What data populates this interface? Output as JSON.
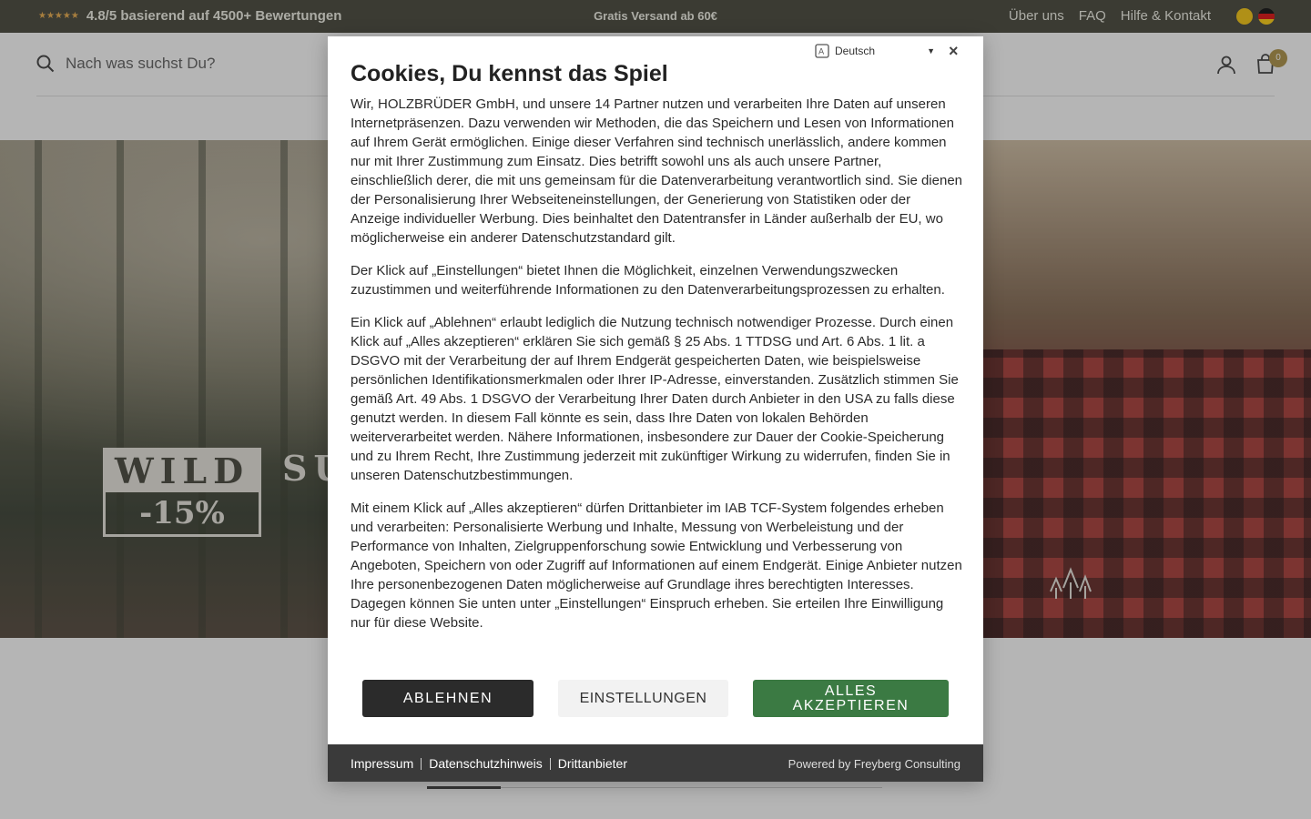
{
  "topbar": {
    "rating_stars": "★★★★★",
    "rating_text": "4.8/5 basierend auf 4500+ Bewertungen",
    "center_text": "Gratis Versand ab 60€",
    "links": [
      "Über uns",
      "FAQ",
      "Hilfe & Kontakt"
    ]
  },
  "header": {
    "search_placeholder": "Nach was suchst Du?",
    "cart_count": "0"
  },
  "hero": {
    "badge_top": "WILD",
    "badge_bottom": "-15%",
    "word": "SU"
  },
  "cookie_modal": {
    "language": "Deutsch",
    "close_icon": "×",
    "title": "Cookies, Du kennst das Spiel",
    "paragraphs": [
      "Wir, HOLZBRÜDER GmbH, und unsere 14 Partner nutzen und verarbeiten Ihre Daten auf unseren Internetpräsenzen. Dazu verwenden wir Methoden, die das Speichern und Lesen von Informationen auf Ihrem Gerät ermöglichen. Einige dieser Verfahren sind technisch unerlässlich, andere kommen nur mit Ihrer Zustimmung zum Einsatz. Dies betrifft sowohl uns als auch unsere Partner, einschließlich derer, die mit uns gemeinsam für die Datenverarbeitung verantwortlich sind. Sie dienen der Personalisierung Ihrer Webseiteneinstellungen, der Generierung von Statistiken oder der Anzeige individueller Werbung. Dies beinhaltet den Datentransfer in Länder außerhalb der EU, wo möglicherweise ein anderer Datenschutzstandard gilt.",
      "Der Klick auf „Einstellungen“ bietet Ihnen die Möglichkeit, einzelnen Verwendungszwecken zuzustimmen und weiterführende Informationen zu den Datenverarbeitungsprozessen zu erhalten.",
      "Ein Klick auf „Ablehnen“ erlaubt lediglich die Nutzung technisch notwendiger Prozesse. Durch einen Klick auf „Alles akzeptieren“ erklären Sie sich gemäß § 25 Abs. 1 TTDSG und Art. 6 Abs. 1 lit. a DSGVO mit der Verarbeitung der auf Ihrem Endgerät gespeicherten Daten, wie beispielsweise persönlichen Identifikationsmerkmalen oder Ihrer IP-Adresse, einverstanden. Zusätzlich stimmen Sie gemäß Art. 49 Abs. 1 DSGVO der Verarbeitung Ihrer Daten durch Anbieter in den USA zu falls diese genutzt werden. In diesem Fall könnte es sein, dass Ihre Daten von lokalen Behörden weiterverarbeitet werden. Nähere Informationen, insbesondere zur Dauer der Cookie-Speicherung und zu Ihrem Recht, Ihre Zustimmung jederzeit mit zukünftiger Wirkung zu widerrufen, finden Sie in unseren Datenschutzbestimmungen.",
      "Mit einem Klick auf „Alles akzeptieren“ dürfen Drittanbieter im IAB TCF-System folgendes erheben und verarbeiten: Personalisierte Werbung und Inhalte, Messung von Werbeleistung und der Performance von Inhalten, Zielgruppenforschung sowie Entwicklung und Verbesserung von Angeboten, Speichern von oder Zugriff auf Informationen auf einem Endgerät. Einige Anbieter nutzen Ihre personenbezogenen Daten möglicherweise auf Grundlage ihres berechtigten Interesses. Dagegen können Sie unten unter „Einstellungen“ Einspruch erheben. Sie erteilen Ihre Einwilligung nur für diese Website."
    ],
    "buttons": {
      "reject": "ABLEHNEN",
      "settings": "EINSTELLUNGEN",
      "accept": "ALLES AKZEPTIEREN"
    },
    "footer": {
      "links": [
        "Impressum",
        "Datenschutzhinweis",
        "Drittanbieter"
      ],
      "powered_by": "Powered by Freyberg Consulting"
    }
  },
  "colors": {
    "topbar_bg": "#3a3a2e",
    "accept_green": "#3b7a43",
    "reject_dark": "#2b2b2b",
    "cart_badge": "#a88b3a",
    "star_orange": "#e8a640"
  },
  "icons": [
    "search-icon",
    "user-icon",
    "cart-icon",
    "language-icon",
    "close-icon",
    "dhl-flag-icon",
    "germany-flag-icon",
    "tree-logo-icon"
  ]
}
